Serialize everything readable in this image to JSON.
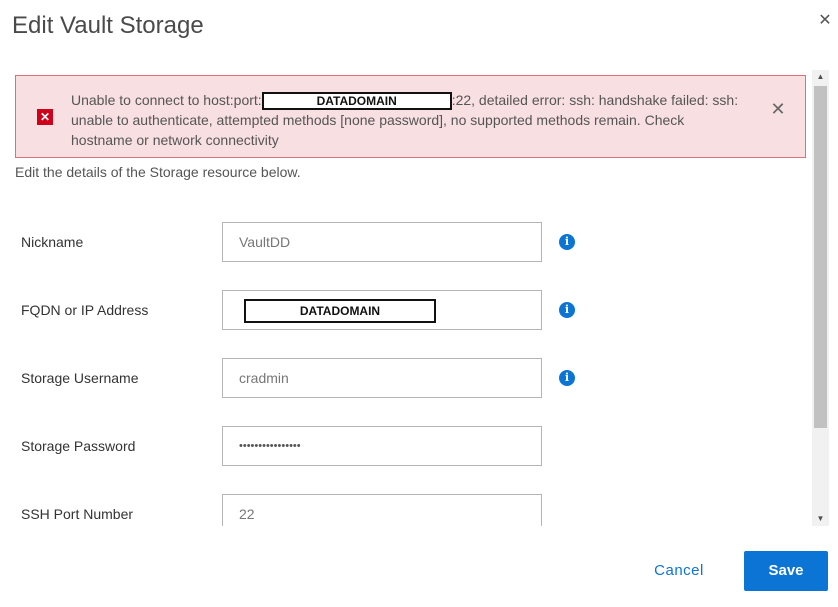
{
  "dialog": {
    "title": "Edit Vault Storage",
    "close_icon": "close-icon"
  },
  "alert": {
    "icon": "error-x-icon",
    "text_before": "Unable to connect to host:port:",
    "redacted_host": "DATADOMAIN",
    "text_after": ":22, detailed error: ssh: handshake failed: ssh: unable to authenticate, attempted methods [none password], no supported methods remain. Check hostname or network connectivity",
    "close_icon": "close-icon"
  },
  "intro": "Edit the details of the Storage resource below.",
  "fields": {
    "nickname": {
      "label": "Nickname",
      "value": "VaultDD"
    },
    "fqdn": {
      "label": "FQDN or IP Address",
      "value": "DATADOMAIN"
    },
    "username": {
      "label": "Storage Username",
      "value": "cradmin"
    },
    "password": {
      "label": "Storage Password",
      "value": "••••••••••••••••"
    },
    "ssh_port": {
      "label": "SSH Port Number",
      "value": "22"
    }
  },
  "buttons": {
    "cancel": "Cancel",
    "save": "Save"
  },
  "colors": {
    "accent": "#0b74d4",
    "alert_bg": "#f8dfe1",
    "alert_border": "#d9737b",
    "error": "#d0021b"
  }
}
